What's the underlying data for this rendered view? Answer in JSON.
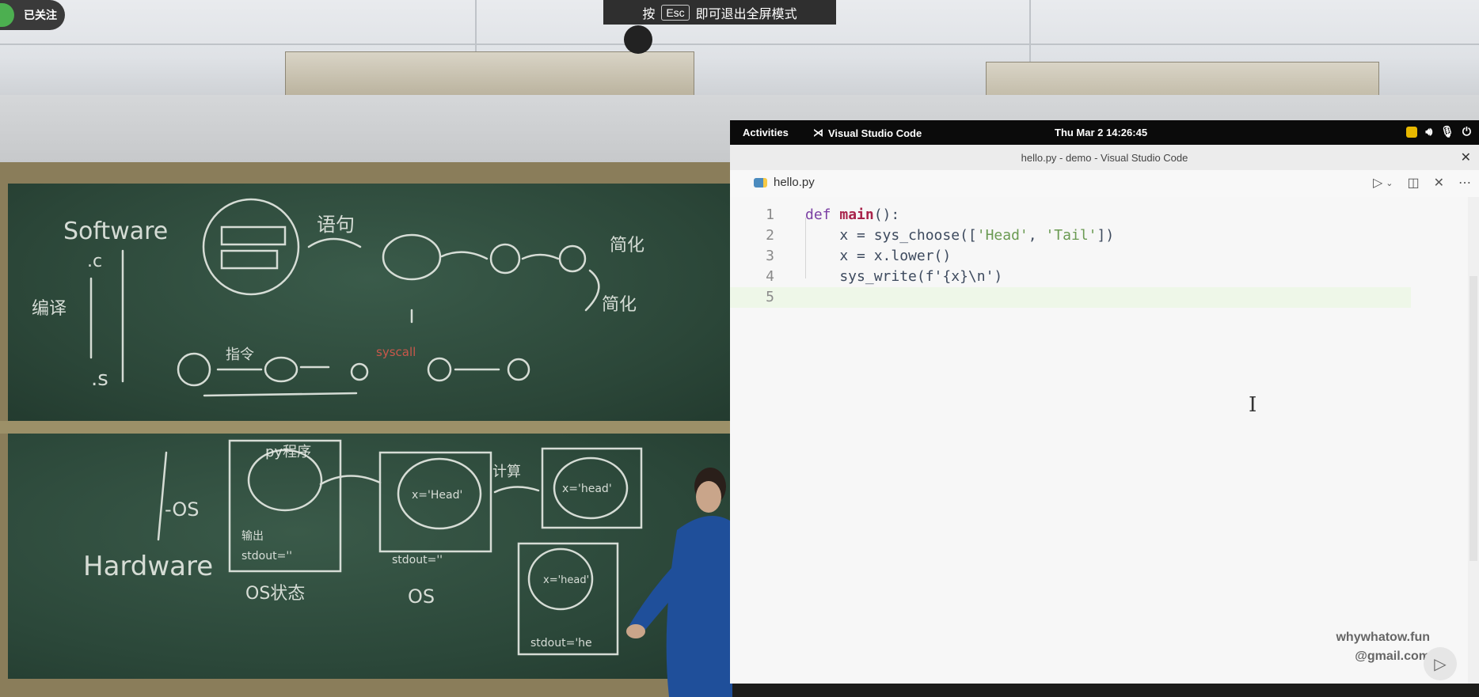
{
  "overlay": {
    "follow_label": "已关注",
    "esc_hint_prefix": "按",
    "esc_key": "Esc",
    "esc_hint_suffix": "即可退出全屏模式"
  },
  "topbar": {
    "activities": "Activities",
    "app_name": "Visual Studio Code",
    "clock": "Thu Mar 2  14:26:45"
  },
  "window": {
    "title": "hello.py - demo - Visual Studio Code"
  },
  "editor": {
    "tab_name": "hello.py",
    "lines": [
      {
        "n": "1",
        "kw": "def",
        "fn": "main",
        "rest": "():"
      },
      {
        "n": "2",
        "code": "    x = sys_choose([",
        "s1": "'Head'",
        "mid": ", ",
        "s2": "'Tail'",
        "end": "])"
      },
      {
        "n": "3",
        "code": "    x = x.lower()"
      },
      {
        "n": "4",
        "code": "    sys_write(f'{x}\\n')"
      },
      {
        "n": "5",
        "code": ""
      }
    ]
  },
  "watermark": {
    "line1": "whywhatow.fun",
    "line2": "@gmail.com"
  },
  "blackboard": {
    "top": [
      "Software",
      ".c",
      "编译",
      ".s",
      "语句",
      "简化",
      "简化",
      "指令",
      "syscall"
    ],
    "bottom": [
      "Hardware",
      "-OS",
      "py程序",
      "输出",
      "stdout=''",
      "OS状态",
      "x='Head'",
      "stdout=''",
      "OS",
      "计算",
      "x='head'",
      "x='head'",
      "stdout='he"
    ]
  }
}
